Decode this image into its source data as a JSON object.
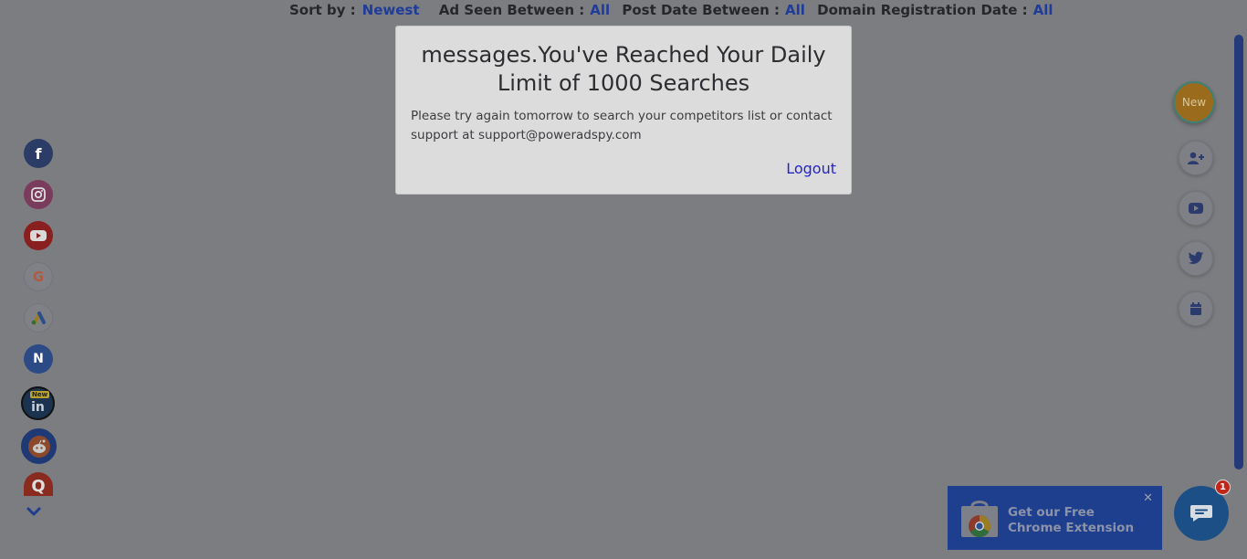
{
  "filters": {
    "sort_label": "Sort by :",
    "sort_value": "Newest",
    "ad_seen_label": "Ad Seen Between :",
    "ad_seen_value": "All",
    "post_date_label": "Post Date Between :",
    "post_date_value": "All",
    "domain_reg_label": "Domain Registration Date :",
    "domain_reg_value": "All"
  },
  "modal": {
    "title": "messages.You've Reached Your Daily Limit of 1000 Searches",
    "body": "Please try again tomorrow to search your competitors list or contact support at support@poweradspy.com",
    "logout_label": "Logout"
  },
  "social": {
    "items": [
      {
        "name": "facebook-icon",
        "glyph": "f",
        "color": "#2b3c66"
      },
      {
        "name": "instagram-icon",
        "glyph": "",
        "color": "#7b3b5c"
      },
      {
        "name": "youtube-icon",
        "glyph": "",
        "color": "#8a1f1f"
      },
      {
        "name": "google-icon",
        "glyph": "G",
        "color": "#808186"
      },
      {
        "name": "google-ads-icon",
        "glyph": "",
        "color": "#808186"
      },
      {
        "name": "native-icon",
        "glyph": "N",
        "color": "#2c4a86"
      },
      {
        "name": "linkedin-icon",
        "glyph": "in",
        "color": "#1c3350"
      },
      {
        "name": "reddit-icon",
        "glyph": "",
        "color": "#1f3975"
      },
      {
        "name": "quora-icon",
        "glyph": "Q",
        "color": "#8a2b20"
      }
    ],
    "linkedin_badge": "New"
  },
  "right": {
    "new_label": "New"
  },
  "extension": {
    "text": "Get our Free Chrome Extension",
    "line1": "Get our Free",
    "line2": "Chrome Extension",
    "close": "✕"
  },
  "chat": {
    "badge": "1"
  }
}
